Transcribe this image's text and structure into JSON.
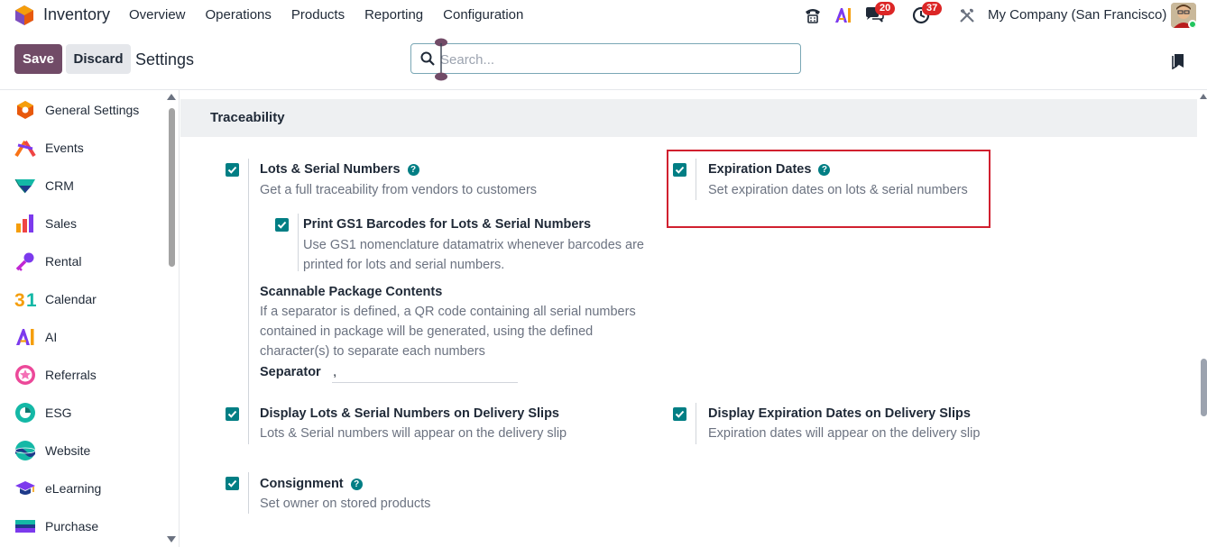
{
  "navbar": {
    "app_name": "Inventory",
    "menu": [
      "Overview",
      "Operations",
      "Products",
      "Reporting",
      "Configuration"
    ],
    "messages_badge": "20",
    "activities_badge": "37",
    "company": "My Company (San Francisco)"
  },
  "control_bar": {
    "save_label": "Save",
    "discard_label": "Discard",
    "title": "Settings",
    "search_placeholder": "Search..."
  },
  "sidebar": {
    "items": [
      {
        "label": "General Settings",
        "icon": "general-settings-icon"
      },
      {
        "label": "Events",
        "icon": "events-icon"
      },
      {
        "label": "CRM",
        "icon": "crm-icon"
      },
      {
        "label": "Sales",
        "icon": "sales-icon"
      },
      {
        "label": "Rental",
        "icon": "rental-icon"
      },
      {
        "label": "Calendar",
        "icon": "calendar-icon"
      },
      {
        "label": "AI",
        "icon": "ai-icon"
      },
      {
        "label": "Referrals",
        "icon": "referrals-icon"
      },
      {
        "label": "ESG",
        "icon": "esg-icon"
      },
      {
        "label": "Website",
        "icon": "website-icon"
      },
      {
        "label": "eLearning",
        "icon": "elearning-icon"
      },
      {
        "label": "Purchase",
        "icon": "purchase-icon"
      }
    ]
  },
  "section": {
    "title": "Traceability",
    "lots": {
      "title": "Lots & Serial Numbers",
      "desc": "Get a full traceability from vendors to customers",
      "checked": true
    },
    "gs1": {
      "title": "Print GS1 Barcodes for Lots & Serial Numbers",
      "desc": "Use GS1 nomenclature datamatrix whenever barcodes are printed for lots and serial numbers.",
      "checked": true
    },
    "scannable": {
      "title": "Scannable Package Contents",
      "desc": "If a separator is defined, a QR code containing all serial numbers contained in package will be generated, using the defined character(s) to separate each numbers",
      "separator_label": "Separator",
      "separator_value": ","
    },
    "expiration": {
      "title": "Expiration Dates",
      "desc": "Set expiration dates on lots & serial numbers",
      "checked": true
    },
    "display_lots": {
      "title": "Display Lots & Serial Numbers on Delivery Slips",
      "desc": "Lots & Serial numbers will appear on the delivery slip",
      "checked": true
    },
    "display_expiration": {
      "title": "Display Expiration Dates on Delivery Slips",
      "desc": "Expiration dates will appear on the delivery slip",
      "checked": true
    },
    "consignment": {
      "title": "Consignment",
      "desc": "Set owner on stored products",
      "checked": true
    }
  },
  "colors": {
    "brand": "#714b67",
    "checkbox": "#017e84",
    "highlight": "#d1202f",
    "badge": "#dc2626"
  }
}
